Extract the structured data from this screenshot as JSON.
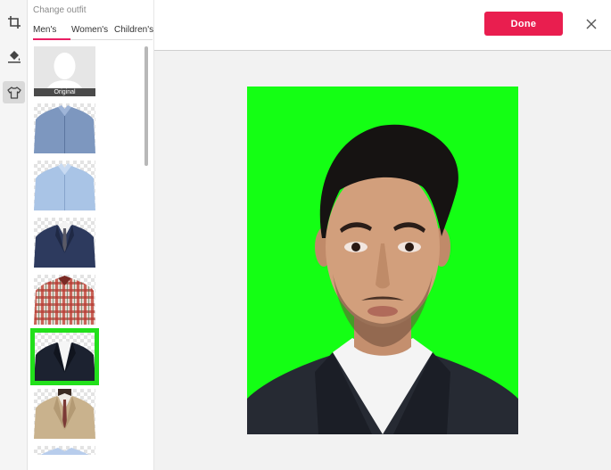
{
  "tools": [
    {
      "name": "crop-icon"
    },
    {
      "name": "paint-bucket-icon"
    },
    {
      "name": "shirt-icon",
      "active": true
    }
  ],
  "panel": {
    "title": "Change outfit",
    "tabs": [
      {
        "label": "Men's",
        "active": true
      },
      {
        "label": "Women's"
      },
      {
        "label": "Children's"
      }
    ],
    "outfits": [
      {
        "label": "Original",
        "kind": "original"
      },
      {
        "kind": "blue-shirt"
      },
      {
        "kind": "light-blue-shirt"
      },
      {
        "kind": "navy-suit-red-tie"
      },
      {
        "kind": "plaid-shirt"
      },
      {
        "kind": "black-suit",
        "selected": true
      },
      {
        "kind": "beige-suit"
      },
      {
        "kind": "pale-blue-shirt"
      }
    ]
  },
  "toolbar": {
    "done_label": "Done",
    "close_icon": "close-icon"
  },
  "photo": {
    "background_color": "#14ff14",
    "subject": "portrait-with-black-suit"
  },
  "colors": {
    "accent": "#e91e4f",
    "selection": "#22e01b"
  }
}
